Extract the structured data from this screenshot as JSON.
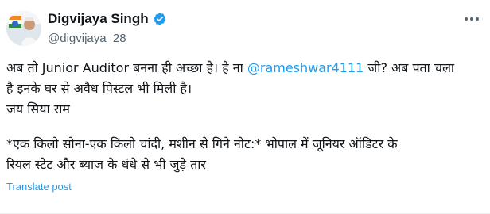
{
  "author": {
    "display_name": "Digvijaya Singh",
    "handle": "@digvijaya_28",
    "verified": true,
    "avatar_icon": "profile-photo-with-party-logo"
  },
  "tweet": {
    "line1_prefix": "अब तो Junior Auditor बनना ही अच्छा है। है ना ",
    "mention": "@rameshwar4111",
    "line1_suffix": " जी? अब पता चला",
    "line2": "है इनके घर से अवैध पिस्टल भी मिली है।",
    "line3": "जय सिया राम",
    "quote_line1": "*एक किलो सोना-एक किलो चांदी, मशीन से गिने नोट:* भोपाल में जूनियर ऑडिटर के",
    "quote_line2": "रियल स्टेट और ब्याज के धंधे से भी जुड़े तार"
  },
  "actions": {
    "translate_label": "Translate post",
    "more_icon": "more-dots-icon"
  },
  "colors": {
    "link": "#1d9bf0",
    "secondary_text": "#536471",
    "verified_badge": "#1d9bf0"
  }
}
